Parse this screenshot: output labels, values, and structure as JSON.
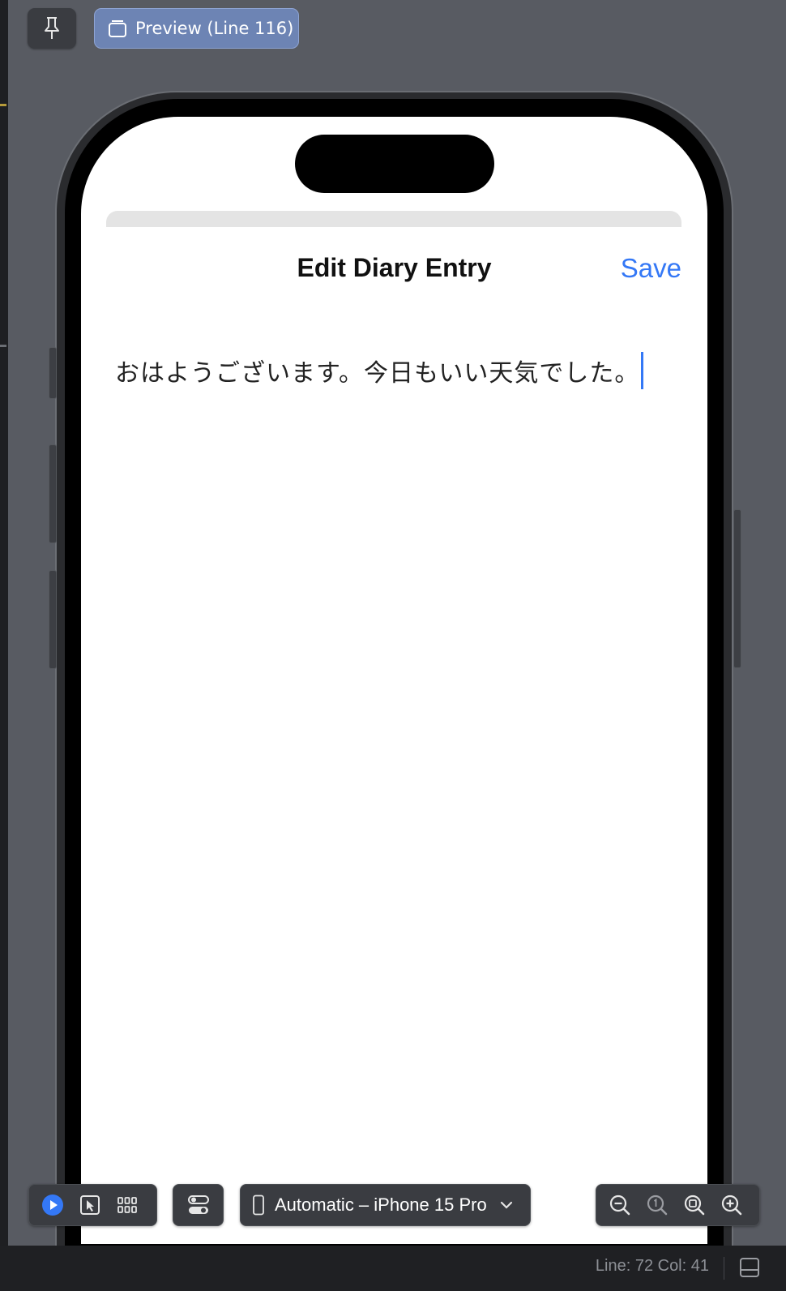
{
  "header": {
    "pin_icon": "pin-icon",
    "preview_tab": {
      "icon": "preview-window-icon",
      "label": "Preview (Line 116)"
    }
  },
  "device": {
    "nav_title": "Edit Diary Entry",
    "save_label": "Save",
    "editor_text": "おはようございます。今日もいい天気でした。",
    "accent": "#3478f6"
  },
  "toolbar": {
    "live_icon": "play-icon",
    "select_icon": "cursor-select-icon",
    "variants_icon": "grid-icon",
    "settings_icon": "toggle-settings-icon",
    "device_selector": {
      "icon": "iphone-icon",
      "label": "Automatic – iPhone 15 Pro",
      "chevron": "chevron-down-icon"
    },
    "zoom": [
      "zoom-out-icon",
      "zoom-actual-size-icon",
      "zoom-to-fit-icon",
      "zoom-in-icon"
    ]
  },
  "status_bar": {
    "position": "Line: 72  Col: 41"
  }
}
